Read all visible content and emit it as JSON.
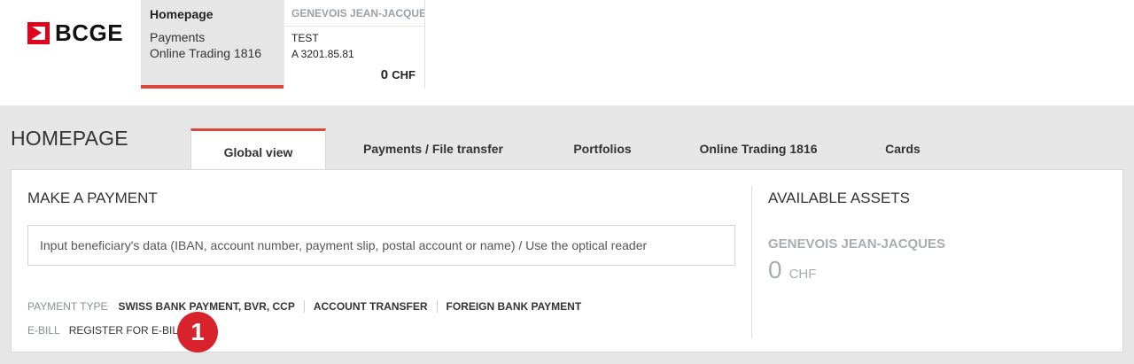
{
  "brand": {
    "name": "BCGE",
    "color": "#e2001a"
  },
  "top_nav": {
    "home": {
      "title": "Homepage",
      "links": [
        "Payments",
        "Online Trading 1816"
      ]
    },
    "account": {
      "owner": "GENEVOIS JEAN-JACQUES",
      "name": "TEST",
      "number": "A 3201.85.81",
      "balance": "0",
      "currency": "CHF"
    }
  },
  "page": {
    "title": "HOMEPAGE"
  },
  "tabs": [
    {
      "label": "Global view",
      "active": true
    },
    {
      "label": "Payments / File transfer",
      "active": false
    },
    {
      "label": "Portfolios",
      "active": false
    },
    {
      "label": "Online Trading 1816",
      "active": false
    },
    {
      "label": "Cards",
      "active": false
    }
  ],
  "payment": {
    "title": "MAKE A PAYMENT",
    "input_placeholder": "Input beneficiary's data (IBAN, account number, payment slip, postal account or name) / Use the optical reader",
    "type_label": "PAYMENT TYPE",
    "types": [
      "SWISS BANK PAYMENT, BVR, CCP",
      "ACCOUNT TRANSFER",
      "FOREIGN BANK PAYMENT"
    ],
    "ebill_label": "E-BILL",
    "ebill_link": "REGISTER FOR E-BILL"
  },
  "annotation": {
    "badge": "1",
    "color": "#d8222c"
  },
  "assets": {
    "title": "AVAILABLE ASSETS",
    "owner": "GENEVOIS JEAN-JACQUES",
    "amount": "0",
    "currency": "CHF"
  },
  "colors": {
    "accent": "#d9483b",
    "band": "#e6e6e6"
  }
}
